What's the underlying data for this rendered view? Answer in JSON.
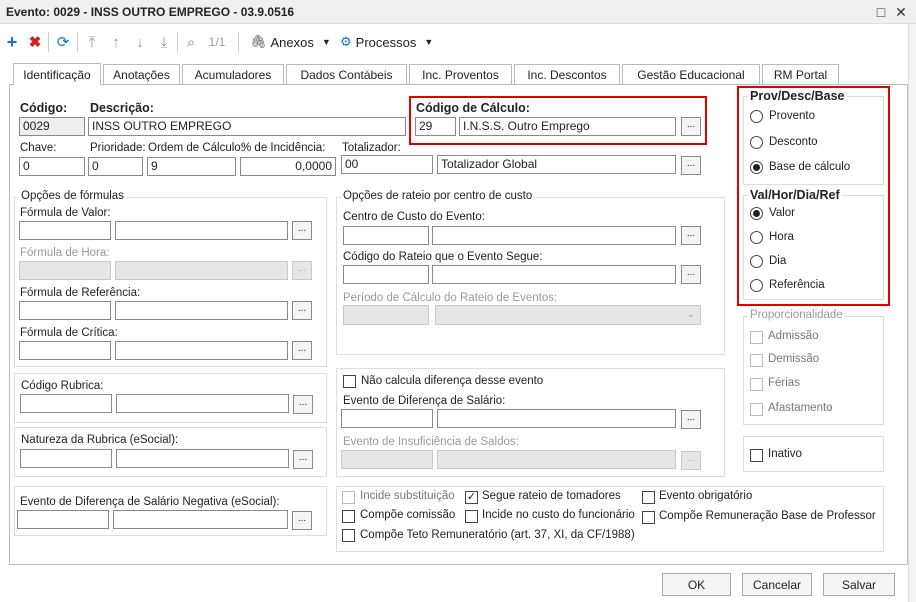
{
  "window": {
    "title": "Evento: 0029 - INSS OUTRO EMPREGO - 03.9.0516"
  },
  "toolbar": {
    "page_indicator": "1/1",
    "attachments_label": "Anexos",
    "processes_label": "Processos"
  },
  "tabs": [
    "Identificação",
    "Anotações",
    "Acumuladores",
    "Dados Contábeis",
    "Inc. Proventos",
    "Inc. Descontos",
    "Gestão Educacional",
    "RM Portal"
  ],
  "fields": {
    "codigo_label": "Código:",
    "codigo_value": "0029",
    "descricao_label": "Descrição:",
    "descricao_value": "INSS OUTRO EMPREGO",
    "codigo_calculo_label": "Código de Cálculo:",
    "codigo_calculo_code": "29",
    "codigo_calculo_desc": "I.N.S.S. Outro Emprego",
    "chave_label": "Chave:",
    "chave_value": "0",
    "prioridade_label": "Prioridade:",
    "prioridade_value": "0",
    "ordem_label": "Ordem de Cálculo:",
    "ordem_value": "9",
    "incidencia_label": "% de Incidência:",
    "incidencia_value": "0,0000",
    "totalizador_label": "Totalizador:",
    "totalizador_code": "00",
    "totalizador_desc": "Totalizador Global"
  },
  "formulas": {
    "title": "Opções de fórmulas",
    "valor": "Fórmula de Valor:",
    "hora": "Fórmula de Hora:",
    "referencia": "Fórmula de Referência:",
    "critica": "Fórmula de Crítica:"
  },
  "rubrica": {
    "codigo": "Código Rubrica:",
    "natureza": "Natureza da Rubrica (eSocial):",
    "evento_neg": "Evento de Diferença de Salário Negativa (eSocial):"
  },
  "rateio": {
    "title": "Opções de rateio por centro de custo",
    "centro": "Centro de Custo do Evento:",
    "codigo_rateio": "Código do Rateio que o Evento Segue:",
    "periodo": "Período de Cálculo do Rateio de Eventos:"
  },
  "diferenca": {
    "nao_calcula": "Não calcula diferença desse evento",
    "evento_dif": "Evento de Diferença de Salário:",
    "evento_insuf": "Evento de Insuficiência de Saldos:"
  },
  "checks": {
    "incide_subst": "Incide substituição",
    "segue_rateio": "Segue rateio de tomadores",
    "evento_obrig": "Evento obrigatório",
    "compoe_comissao": "Compõe comissão",
    "incide_custo": "Incide no custo do funcionário",
    "compoe_rem_prof": "Compõe Remuneração Base de Professor",
    "compoe_teto": "Compõe Teto Remuneratório (art. 37, XI, da CF/1988)"
  },
  "prov": {
    "title": "Prov/Desc/Base",
    "opt1": "Provento",
    "opt2": "Desconto",
    "opt3": "Base de cálculo",
    "selected": "Base de cálculo"
  },
  "valhor": {
    "title": "Val/Hor/Dia/Ref",
    "opt1": "Valor",
    "opt2": "Hora",
    "opt3": "Dia",
    "opt4": "Referência",
    "selected": "Valor"
  },
  "proporc": {
    "title": "Proporcionalidade",
    "admissao": "Admissão",
    "demissao": "Demissão",
    "ferias": "Férias",
    "afastamento": "Afastamento"
  },
  "inativo": "Inativo",
  "buttons": {
    "ok": "OK",
    "cancel": "Cancelar",
    "save": "Salvar"
  },
  "colors": {
    "accent": "#1a73c9",
    "delete": "#d32020",
    "highlight": "#e00000"
  }
}
